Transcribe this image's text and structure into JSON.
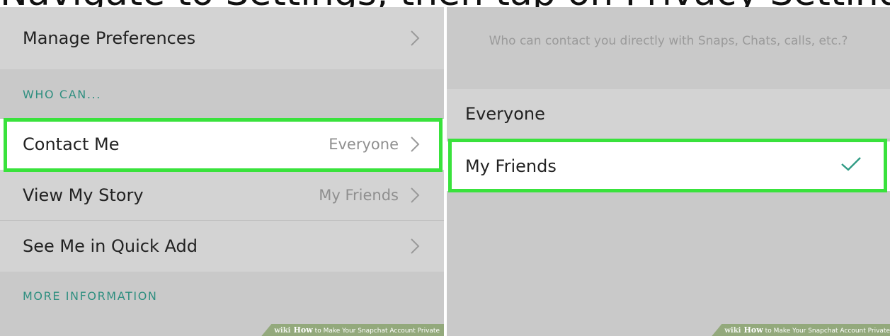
{
  "header": {
    "title_text": "Navigate to Settings, then tap on Privacy Settings"
  },
  "left_panel": {
    "manage_preferences": {
      "label": "Manage Preferences"
    },
    "section_who_can": "WHO CAN...",
    "contact_me": {
      "label": "Contact Me",
      "value": "Everyone"
    },
    "view_my_story": {
      "label": "View My Story",
      "value": "My Friends"
    },
    "see_me_quick_add": {
      "label": "See Me in Quick Add"
    },
    "section_more_info": "MORE INFORMATION"
  },
  "right_panel": {
    "question": "Who can contact you directly with Snaps, Chats, calls, etc.?",
    "options": [
      {
        "label": "Everyone",
        "selected": false
      },
      {
        "label": "My Friends",
        "selected": true
      }
    ]
  },
  "watermark": {
    "brand_prefix": "wiki",
    "brand_how": "How",
    "text": "to Make Your Snapchat Account Private"
  },
  "colors": {
    "highlight": "#39e23c",
    "accent": "#2f8f80",
    "background": "#c9c9c9",
    "checkmark": "#2f9b84"
  },
  "icons": {
    "chevron": "chevron-right-icon",
    "check": "checkmark-icon"
  }
}
